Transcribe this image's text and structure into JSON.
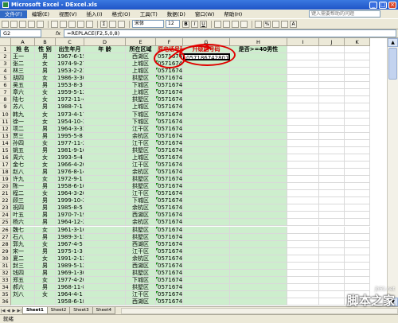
{
  "window": {
    "title": "Microsoft Excel - DExcel.xls"
  },
  "menu": {
    "items": [
      "文件(F)",
      "编辑(E)",
      "视图(V)",
      "插入(I)",
      "格式(O)",
      "工具(T)",
      "数据(D)",
      "窗口(W)",
      "帮助(H)"
    ],
    "help_placeholder": "键入需要帮助的问题"
  },
  "toolbar": {
    "font": "宋体",
    "size": "12"
  },
  "formula_bar": {
    "name_box": "G2",
    "fx": "fx",
    "formula": "=REPLACE(F2,5,0,8)"
  },
  "columns": [
    "A",
    "B",
    "C",
    "D",
    "E",
    "F",
    "G",
    "H",
    "I",
    "J",
    "K"
  ],
  "header_row": [
    "姓 名",
    "性 别",
    "出生年月",
    "年 龄",
    "所在区域",
    "原电话号码",
    "升级后号码",
    "是否>=40男性",
    "",
    "",
    ""
  ],
  "rows": [
    [
      "王一",
      "男",
      "1967-6-15",
      "",
      "西湖区",
      "05716742801",
      "057186742801"
    ],
    [
      "张二",
      "女",
      "1974-9-27",
      "",
      "上城区",
      "05716742802",
      ""
    ],
    [
      "林三",
      "男",
      "1953-2-21",
      "",
      "上城区",
      "05716742803",
      ""
    ],
    [
      "胡四",
      "女",
      "1986-3-30",
      "",
      "拱墅区",
      "05716742804",
      ""
    ],
    [
      "吴五",
      "男",
      "1953-8-3",
      "",
      "下城区",
      "05716742805",
      ""
    ],
    [
      "章六",
      "女",
      "1959-5-12",
      "",
      "上城区",
      "05716742806",
      ""
    ],
    [
      "陆七",
      "女",
      "1972-11-4",
      "",
      "拱墅区",
      "05716742807",
      ""
    ],
    [
      "苏八",
      "男",
      "1988-7-1",
      "",
      "上城区",
      "05716742808",
      ""
    ],
    [
      "韩九",
      "女",
      "1973-4-17",
      "",
      "下城区",
      "05716742809",
      ""
    ],
    [
      "徐一",
      "女",
      "1954-10-3",
      "",
      "下城区",
      "05716742810",
      ""
    ],
    [
      "项二",
      "男",
      "1964-3-31",
      "",
      "江干区",
      "05716742811",
      ""
    ],
    [
      "贾三",
      "男",
      "1995-5-8",
      "",
      "余杭区",
      "05716742812",
      ""
    ],
    [
      "孙四",
      "女",
      "1977-11-25",
      "",
      "江干区",
      "05716742813",
      ""
    ],
    [
      "姚五",
      "男",
      "1981-9-16",
      "",
      "拱墅区",
      "05716742814",
      ""
    ],
    [
      "周六",
      "女",
      "1993-5-4",
      "",
      "上城区",
      "05716742815",
      ""
    ],
    [
      "金七",
      "女",
      "1966-4-20",
      "",
      "江干区",
      "05716742816",
      ""
    ],
    [
      "赵八",
      "男",
      "1976-8-14",
      "",
      "余杭区",
      "05716742817",
      ""
    ],
    [
      "许九",
      "女",
      "1972-9-1",
      "",
      "拱墅区",
      "05716742818",
      ""
    ],
    [
      "陈一",
      "男",
      "1958-6-10",
      "",
      "拱墅区",
      "05716742819",
      ""
    ],
    [
      "程二",
      "女",
      "1964-3-20",
      "",
      "江干区",
      "05716742820",
      ""
    ],
    [
      "顾三",
      "男",
      "1999-10-24",
      "",
      "下城区",
      "05716742821",
      ""
    ],
    [
      "祝四",
      "男",
      "1985-8-5",
      "",
      "余杭区",
      "05716742822",
      ""
    ],
    [
      "叶五",
      "男",
      "1970-7-19",
      "",
      "西湖区",
      "05716742823",
      ""
    ],
    [
      "杨六",
      "男",
      "1964-12-21",
      "",
      "余杭区",
      "05716742824",
      ""
    ],
    [
      "魏七",
      "女",
      "1961-3-16",
      "",
      "拱墅区",
      "05716742825",
      ""
    ],
    [
      "石八",
      "男",
      "1989-3-11",
      "",
      "拱墅区",
      "05716742826",
      ""
    ],
    [
      "郭九",
      "女",
      "1967-4-5",
      "",
      "西湖区",
      "05716742827",
      ""
    ],
    [
      "宋一",
      "男",
      "1975-1-3",
      "",
      "江干区",
      "05716742828",
      ""
    ],
    [
      "夏二",
      "女",
      "1991-2-12",
      "",
      "余杭区",
      "05716742829",
      ""
    ],
    [
      "封三",
      "男",
      "1989-5-12",
      "",
      "西湖区",
      "05716742830",
      ""
    ],
    [
      "钱四",
      "男",
      "1969-1-30",
      "",
      "拱墅区",
      "05716742831",
      ""
    ],
    [
      "郑五",
      "女",
      "1977-4-20",
      "",
      "下城区",
      "05716742832",
      ""
    ],
    [
      "郝六",
      "男",
      "1968-11-8",
      "",
      "拱墅区",
      "05716742833",
      ""
    ],
    [
      "刘八",
      "女",
      "1964-4-1",
      "",
      "江干区",
      "05716742834",
      ""
    ],
    [
      "",
      "",
      "1958-6-18",
      "",
      "西湖区",
      "05716742835",
      ""
    ]
  ],
  "sheet_tabs": [
    "Sheet1",
    "Sheet2",
    "Sheet3",
    "Sheet4"
  ],
  "active_sheet": "Sheet1",
  "status": "就绪",
  "watermark": {
    "line1": "脚本之家",
    "line2": "jb51.net"
  }
}
